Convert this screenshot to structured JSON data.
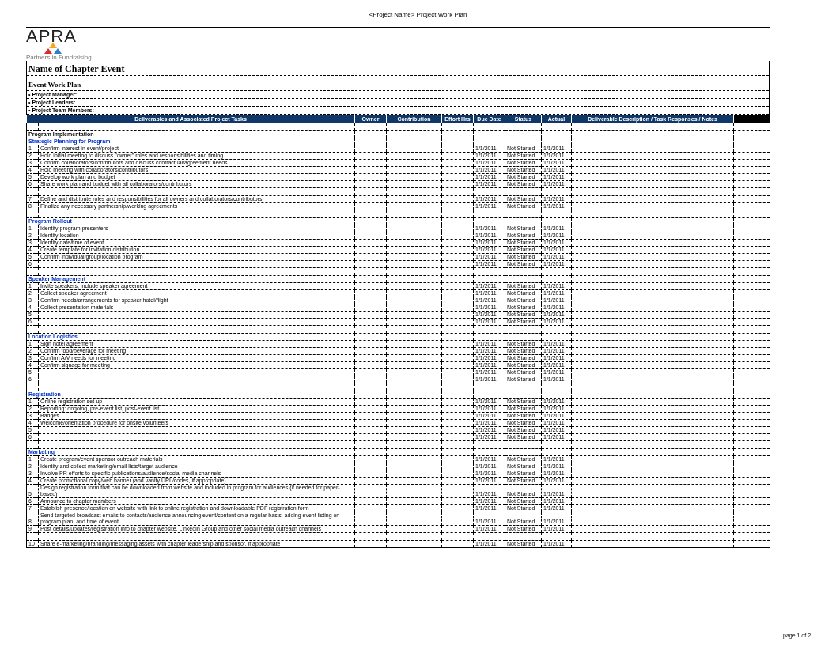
{
  "page_header": "<Project Name>  Project Work Plan",
  "logo": {
    "wordmark": "APRA",
    "tagline": "Partners in Fundraising"
  },
  "event_title": "Name of Chapter Event",
  "plan_title": "Event Work Plan",
  "team_lines": [
    "• Project Manager:",
    "• Project Leaders:",
    "• Project Team Members:"
  ],
  "table": {
    "columns": [
      "Deliverables and Associated Project Tasks",
      "Owner",
      "Contribution",
      "Effort Hrs",
      "Due Date",
      "Status",
      "Actual",
      "Deliverable Description / Task Responses / Notes"
    ],
    "rows": [
      {
        "kind": "spacer"
      },
      {
        "kind": "heading",
        "text": "Program Implementation"
      },
      {
        "kind": "section",
        "text": "Strategic Planning for Program"
      },
      {
        "kind": "task",
        "number": "1",
        "task": "Confirm interest in event/project",
        "due_date": "1/1/2011",
        "status": "Not Started",
        "actual": "1/1/2011"
      },
      {
        "kind": "task",
        "number": "2",
        "task": "Hold initial meeting to discuss \"owner\" roles and responsibilities and timing",
        "due_date": "1/1/2011",
        "status": "Not Started",
        "actual": "1/1/2011"
      },
      {
        "kind": "task",
        "number": "3",
        "task": "Confirm collaborators/contributors and discuss contractual/agreement needs",
        "due_date": "1/1/2011",
        "status": "Not Started",
        "actual": "1/1/2011"
      },
      {
        "kind": "task",
        "number": "4",
        "task": "Hold meeting with collaborators/contributors",
        "due_date": "1/1/2011",
        "status": "Not Started",
        "actual": "1/1/2011"
      },
      {
        "kind": "task",
        "number": "5",
        "task": "Develop work plan and budget",
        "due_date": "1/1/2011",
        "status": "Not Started",
        "actual": "1/1/2011"
      },
      {
        "kind": "task",
        "number": "6",
        "task": "Share work plan and budget with all collaborators/contributors",
        "due_date": "1/1/2011",
        "status": "Not Started",
        "actual": "1/1/2011"
      },
      {
        "kind": "spacer"
      },
      {
        "kind": "task",
        "number": "7",
        "task": "Define and distribute roles and responsibilities for all owners and collaborators/contributors",
        "due_date": "1/1/2011",
        "status": "Not Started",
        "actual": "1/1/2011"
      },
      {
        "kind": "task",
        "number": "8",
        "task": "Finalize any necessary partnership/working agreements",
        "due_date": "1/1/2011",
        "status": "Not Started",
        "actual": "1/1/2011"
      },
      {
        "kind": "spacer"
      },
      {
        "kind": "section",
        "text": "Program Rollout"
      },
      {
        "kind": "task",
        "number": "1",
        "task": "Identify program presenters",
        "due_date": "1/1/2011",
        "status": "Not Started",
        "actual": "1/1/2011"
      },
      {
        "kind": "task",
        "number": "2",
        "task": "Identify location",
        "due_date": "1/1/2011",
        "status": "Not Started",
        "actual": "1/1/2011"
      },
      {
        "kind": "task",
        "number": "3",
        "task": "Identify date/time of event",
        "due_date": "1/1/2011",
        "status": "Not Started",
        "actual": "1/1/2011"
      },
      {
        "kind": "task",
        "number": "4",
        "task": "Create template for invitation distribution",
        "due_date": "1/1/2011",
        "status": "Not Started",
        "actual": "1/1/2011"
      },
      {
        "kind": "task",
        "number": "5",
        "task": "Confirm individual/group/location program",
        "due_date": "1/1/2011",
        "status": "Not Started",
        "actual": "1/1/2011"
      },
      {
        "kind": "task",
        "number": "6",
        "due_date": "1/1/2011",
        "status": "Not Started",
        "actual": "1/1/2011"
      },
      {
        "kind": "spacer"
      },
      {
        "kind": "section",
        "text": "Speaker Management"
      },
      {
        "kind": "task",
        "number": "1",
        "task": "Invite speakers, include speaker agreement",
        "due_date": "1/1/2011",
        "status": "Not Started",
        "actual": "1/1/2011"
      },
      {
        "kind": "task",
        "number": "2",
        "task": "Collect speaker agreement",
        "due_date": "1/1/2011",
        "status": "Not Started",
        "actual": "1/1/2011"
      },
      {
        "kind": "task",
        "number": "3",
        "task": "Confirm needs/arrangements for speaker hotel/flight",
        "due_date": "1/1/2011",
        "status": "Not Started",
        "actual": "1/1/2011"
      },
      {
        "kind": "task",
        "number": "4",
        "task": "Collect presentation materials",
        "due_date": "1/1/2011",
        "status": "Not Started",
        "actual": "1/1/2011"
      },
      {
        "kind": "task",
        "number": "5",
        "due_date": "1/1/2011",
        "status": "Not Started",
        "actual": "1/1/2011"
      },
      {
        "kind": "task",
        "number": "6",
        "due_date": "1/1/2011",
        "status": "Not Started",
        "actual": "1/1/2011"
      },
      {
        "kind": "spacer"
      },
      {
        "kind": "section",
        "text": "Location Logistics"
      },
      {
        "kind": "task",
        "number": "1",
        "task": "Sign hotel agreement",
        "due_date": "1/1/2011",
        "status": "Not Started",
        "actual": "1/1/2011"
      },
      {
        "kind": "task",
        "number": "2",
        "task": "Confirm food/beverage for meeting",
        "due_date": "1/1/2011",
        "status": "Not Started",
        "actual": "1/1/2011"
      },
      {
        "kind": "task",
        "number": "3",
        "task": "Confirm A/V needs for meeting",
        "due_date": "1/1/2011",
        "status": "Not Started",
        "actual": "1/1/2011"
      },
      {
        "kind": "task",
        "number": "4",
        "task": "Confirm signage for meeting",
        "due_date": "1/1/2011",
        "status": "Not Started",
        "actual": "1/1/2011"
      },
      {
        "kind": "task",
        "number": "5",
        "due_date": "1/1/2011",
        "status": "Not Started",
        "actual": "1/1/2011"
      },
      {
        "kind": "task",
        "number": "6",
        "due_date": "1/1/2011",
        "status": "Not Started",
        "actual": "1/1/2011"
      },
      {
        "kind": "spacer"
      },
      {
        "kind": "section",
        "text": "Registration"
      },
      {
        "kind": "task",
        "number": "1",
        "task": "Online registration set-up",
        "due_date": "1/1/2011",
        "status": "Not Started",
        "actual": "1/1/2011"
      },
      {
        "kind": "task",
        "number": "2",
        "task": "Reporting: ongoing, pre-event list, post-event list",
        "due_date": "1/1/2011",
        "status": "Not Started",
        "actual": "1/1/2011"
      },
      {
        "kind": "task",
        "number": "3",
        "task": "Badges",
        "due_date": "1/1/2011",
        "status": "Not Started",
        "actual": "1/1/2011"
      },
      {
        "kind": "task",
        "number": "4",
        "task": "Welcome/orientation procedure for onsite volunteers",
        "due_date": "1/1/2011",
        "status": "Not Started",
        "actual": "1/1/2011"
      },
      {
        "kind": "task",
        "number": "5",
        "due_date": "1/1/2011",
        "status": "Not Started",
        "actual": "1/1/2011"
      },
      {
        "kind": "task",
        "number": "6",
        "due_date": "1/1/2011",
        "status": "Not Started",
        "actual": "1/1/2011"
      },
      {
        "kind": "spacer"
      },
      {
        "kind": "section",
        "text": "Marketing"
      },
      {
        "kind": "task",
        "number": "1",
        "task": "Create program/event sponsor outreach materials",
        "due_date": "1/1/2011",
        "status": "Not Started",
        "actual": "1/1/2011"
      },
      {
        "kind": "task",
        "number": "2",
        "task": "Identify and collect marketing/email lists/target audience",
        "due_date": "1/1/2011",
        "status": "Not Started",
        "actual": "1/1/2011"
      },
      {
        "kind": "task",
        "number": "3",
        "task": "Involve PR efforts to specific publications/audience/social media channels",
        "due_date": "1/1/2011",
        "status": "Not Started",
        "actual": "1/1/2011"
      },
      {
        "kind": "task",
        "number": "4",
        "task": "Create promotional copy/web banner (and vanity URL/codes, if appropriate)",
        "due_date": "1/1/2011",
        "status": "Not Started",
        "actual": "1/1/2011"
      },
      {
        "kind": "task",
        "number": "5",
        "task": "Design registration form that can be downloaded from website and included in program for audiences (if needed for paper-based)",
        "due_date": "1/1/2011",
        "status": "Not Started",
        "actual": "1/1/2011"
      },
      {
        "kind": "task",
        "number": "6",
        "task": "Announce to chapter members",
        "due_date": "1/1/2011",
        "status": "Not Started",
        "actual": "1/1/2011"
      },
      {
        "kind": "task",
        "number": "7",
        "task": "Establish presence/location on website with link to online registration and downloadable PDF registration form",
        "due_date": "1/1/2011",
        "status": "Not Started",
        "actual": "1/1/2011"
      },
      {
        "kind": "task",
        "number": "8",
        "task": "Send targeted broadcast emails to contacts/audience announcing event/content on a regular basis, adding event listing on program plan, and time of event",
        "due_date": "1/1/2011",
        "status": "Not Started",
        "actual": "1/1/2011"
      },
      {
        "kind": "task",
        "number": "9",
        "task": "Post details/updates/registration info to chapter website, LinkedIn Group and other social media outreach channels",
        "due_date": "1/1/2011",
        "status": "Not Started",
        "actual": "1/1/2011"
      },
      {
        "kind": "spacer"
      },
      {
        "kind": "task",
        "number": "10",
        "task": "Share e-marketing/branding/messaging assets with chapter leadership and sponsor, if appropriate",
        "due_date": "1/1/2011",
        "status": "Not Started",
        "actual": "1/1/2011"
      }
    ]
  },
  "page_footer": "page 1 of 2"
}
